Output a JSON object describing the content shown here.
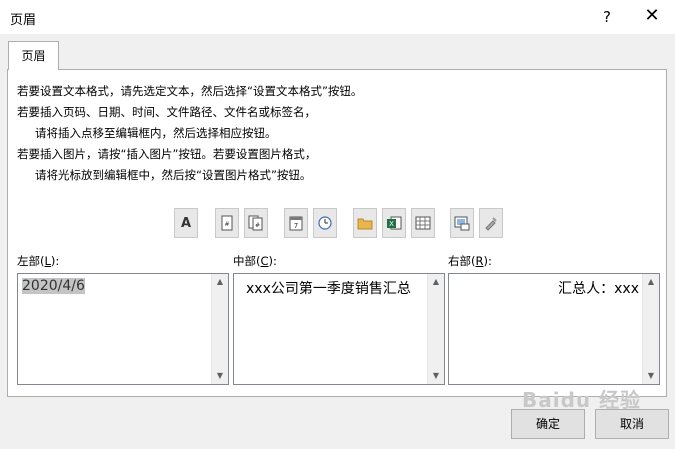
{
  "window": {
    "title": "页眉",
    "help": "?",
    "close": "✕"
  },
  "tab": {
    "label": "页眉"
  },
  "instructions": [
    "若要设置文本格式，请先选定文本，然后选择“设置文本格式”按钮。",
    "若要插入页码、日期、时间、文件路径、文件名或标签名，",
    "请将插入点移至编辑框内，然后选择相应按钮。",
    "若要插入图片，请按“插入图片”按钮。若要设置图片格式，",
    "请将光标放到编辑框中，然后按“设置图片格式”按钮。"
  ],
  "toolbar": {
    "format_text": "A",
    "icons": [
      "format-text-icon",
      "page-number-icon",
      "page-count-icon",
      "date-icon",
      "time-icon",
      "file-path-icon",
      "file-name-icon",
      "sheet-name-icon",
      "insert-picture-icon",
      "format-picture-icon"
    ]
  },
  "sections": {
    "left": {
      "label": "左部",
      "hotkey": "L",
      "value": "2020/4/6"
    },
    "center": {
      "label": "中部",
      "hotkey": "C",
      "value": "xxx公司第一季度销售汇总"
    },
    "right": {
      "label": "右部",
      "hotkey": "R",
      "value": "汇总人：xxx"
    }
  },
  "buttons": {
    "ok": "确定",
    "cancel": "取消"
  },
  "watermark": "Baidu 经验"
}
